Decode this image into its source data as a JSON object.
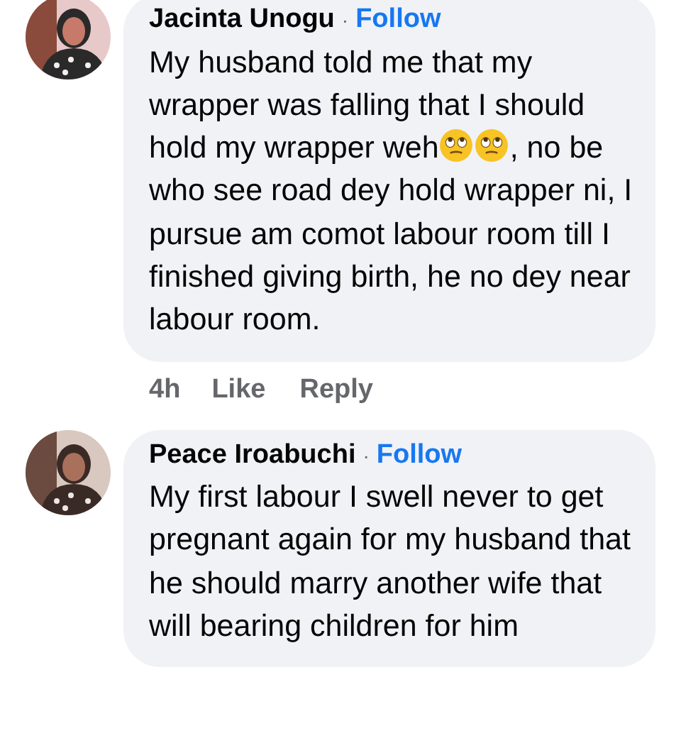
{
  "comments": [
    {
      "author": "Jacinta Unogu",
      "separator": "·",
      "follow": "Follow",
      "avatar": {
        "kind": "picture"
      },
      "body": [
        {
          "kind": "text",
          "text": "My husband told me that my wrapper was falling that I should hold my wrapper weh"
        },
        {
          "kind": "emoji"
        },
        {
          "kind": "emoji"
        },
        {
          "kind": "text",
          "text": ", no be who see road dey hold wrapper ni, I pursue am comot labour room till I finished giving birth, he no dey near labour room."
        }
      ],
      "actions": {
        "time": "4h",
        "like": "Like",
        "reply": "Reply"
      }
    },
    {
      "author": "Peace Iroabuchi",
      "separator": "·",
      "follow": "Follow",
      "avatar": {
        "kind": "picture"
      },
      "body": [
        {
          "kind": "text",
          "text": "My first labour I swell never to get pregnant again for my husband that he should marry another wife that will bearing children for him"
        }
      ]
    }
  ]
}
